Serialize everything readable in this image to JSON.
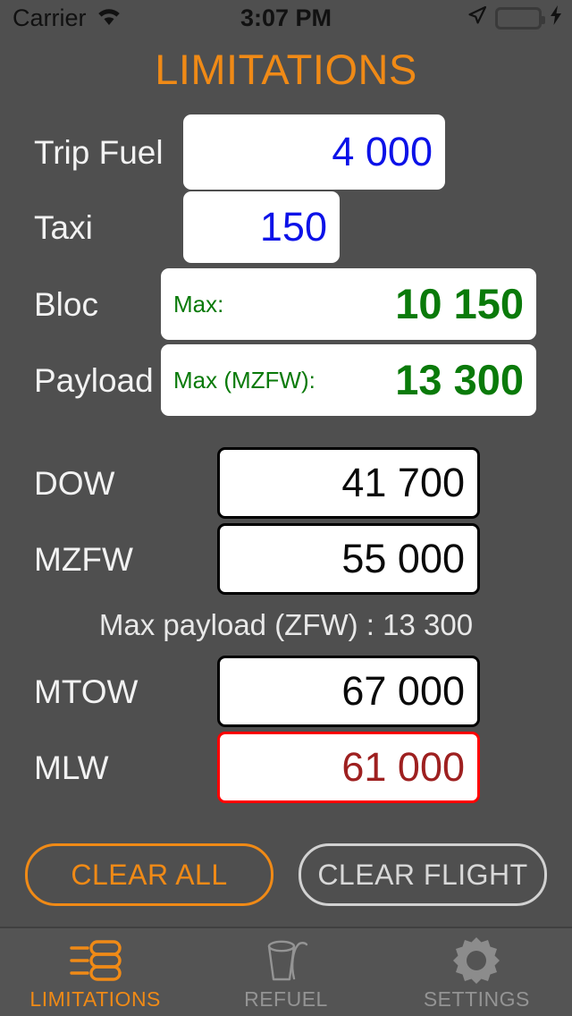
{
  "statusbar": {
    "carrier": "Carrier",
    "wifi_icon": "wifi-icon",
    "time": "3:07 PM",
    "location_icon": "location-arrow-icon",
    "battery_icon": "battery-full-icon",
    "charging_icon": "lightning-bolt-icon",
    "battery_color": "#4CD363"
  },
  "header": {
    "title": "LIMITATIONS",
    "accent_color": "#F08A16"
  },
  "rows": [
    {
      "label": "Trip Fuel",
      "value": "4 000",
      "sublabel": "",
      "value_color": "#0C12E8",
      "border": "none"
    },
    {
      "label": "Taxi",
      "value": "150",
      "sublabel": "",
      "value_color": "#0C12E8",
      "border": "none"
    },
    {
      "label": "Bloc",
      "value": "10 150",
      "sublabel": "Max:",
      "value_color": "#0a7a0a",
      "border": "none"
    },
    {
      "label": "Payload",
      "value": "13 300",
      "sublabel": "Max (MZFW):",
      "value_color": "#0a7a0a",
      "border": "none"
    },
    {
      "label": "DOW",
      "value": "41 700",
      "sublabel": "",
      "value_color": "#0a0a0a",
      "border": "#000000"
    },
    {
      "label": "MZFW",
      "value": "55 000",
      "sublabel": "",
      "value_color": "#0a0a0a",
      "border": "#000000"
    },
    {
      "label": "MTOW",
      "value": "67 000",
      "sublabel": "",
      "value_color": "#0a0a0a",
      "border": "#000000"
    },
    {
      "label": "MLW",
      "value": "61 000",
      "sublabel": "",
      "value_color": "#9E2020",
      "border": "#FF0000"
    }
  ],
  "note": "Max payload (ZFW) : 13 300",
  "buttons": {
    "clear_all": "CLEAR ALL",
    "clear_flight": "CLEAR FLIGHT"
  },
  "tabbar": {
    "items": [
      {
        "label": "LIMITATIONS",
        "icon": "sliders-icon",
        "active": true
      },
      {
        "label": "REFUEL",
        "icon": "cup-straw-icon",
        "active": false
      },
      {
        "label": "SETTINGS",
        "icon": "gear-icon",
        "active": false
      }
    ]
  }
}
